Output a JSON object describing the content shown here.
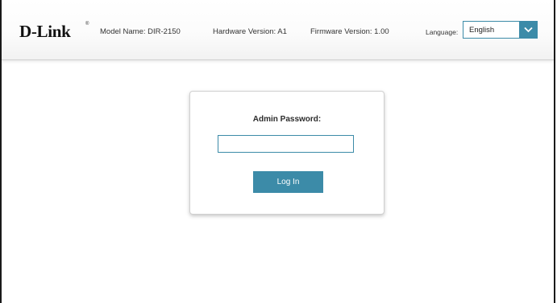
{
  "header": {
    "logo_text": "D-Link",
    "logo_mark": "®",
    "model_name": "Model Name: DIR-2150",
    "hardware_version": "Hardware Version: A1",
    "firmware_version": "Firmware Version: 1.00",
    "language_label": "Language:",
    "language_selected": "English",
    "language_icon": "chevron-down-icon"
  },
  "login": {
    "password_label": "Admin Password:",
    "password_value": "",
    "login_button_label": "Log In"
  },
  "colors": {
    "accent": "#3c8ba8",
    "text": "#333333",
    "background": "#ffffff"
  }
}
